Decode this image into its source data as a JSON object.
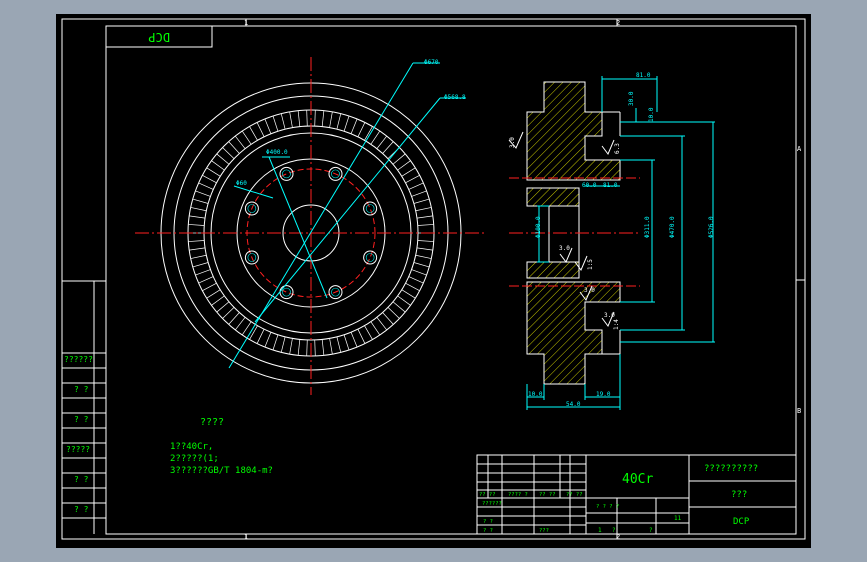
{
  "drawing": {
    "stamp_text": "DCP",
    "zone_top": "2",
    "zone_bottom": "2",
    "zone_top_left": "1",
    "zone_bottom_left": "1",
    "zone_right_top": "A",
    "zone_right_bottom": "B",
    "left_panel_labels": [
      "??????",
      "? ?",
      "? ?",
      "?????",
      "? ?",
      "? ?"
    ]
  },
  "dimensions": {
    "front": {
      "d670": "Φ670",
      "d568": "Φ568.8",
      "d400": "Φ400.0",
      "d60": "Φ60"
    },
    "section": {
      "top_width": "81.0",
      "step1": "30.0",
      "step2": "10.0",
      "bore1": "60.0",
      "bore2": "81.0",
      "dia_small": "Φ100.0",
      "dia_mid": "Φ311.0",
      "dia_mid2": "Φ470.0",
      "dia_large": "Φ526.0",
      "rough1": "3.0",
      "rough2": "3.0",
      "rough3": "3.0",
      "rough4": "3.0",
      "rough5": "6.3",
      "bottom_left": "10.0",
      "bottom_right": "19.0",
      "bottom_total": "54.0",
      "angle_left": "1:5",
      "angle_right": "1:4"
    }
  },
  "notes": {
    "title": "????",
    "lines": [
      "1??40Cr,",
      "2?????(1;",
      "3??????GB/T 1804-m?"
    ]
  },
  "title_block": {
    "material": "40Cr",
    "drawing_name": "??????????",
    "unit": "???",
    "company": "DCP",
    "row_labels": [
      "?? ??",
      "???? ?",
      "??????",
      "?? ??",
      "?? ??"
    ],
    "scale_label": "? ? ? ?",
    "sheet_info": [
      "1",
      "?",
      "?",
      "11"
    ],
    "sign_labels": [
      "? ?",
      "? ?",
      "???"
    ]
  },
  "colors": {
    "background": "#000000",
    "frame": "#ffffff",
    "geometry": "#ffffff",
    "dimension": "#00ffff",
    "centerline": "#ff2020",
    "text": "#00ff00",
    "hatch": "#ffff00",
    "outer_bg": "#9aa6b4"
  }
}
